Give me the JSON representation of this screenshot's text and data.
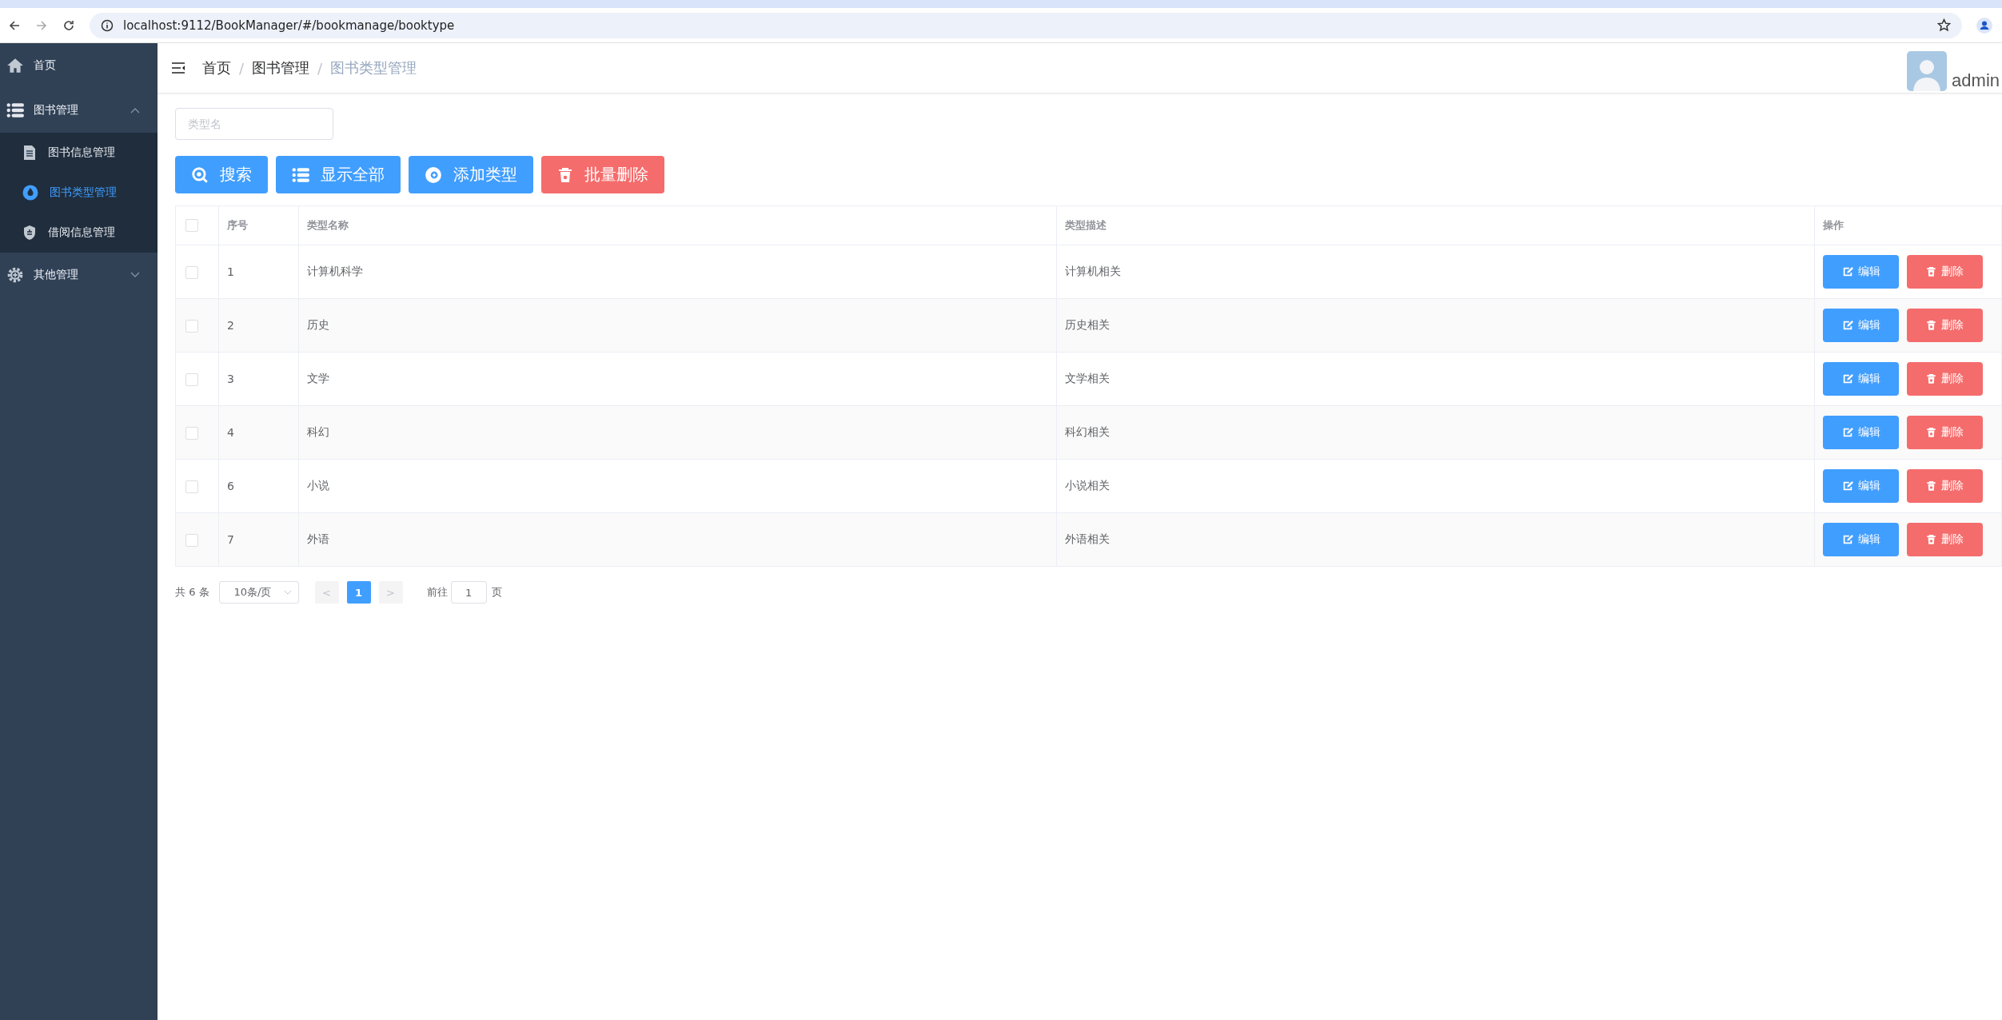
{
  "browser": {
    "url": "localhost:9112/BookManager/#/bookmanage/booktype"
  },
  "sidebar": {
    "items": [
      {
        "label": "首页",
        "selected": false
      },
      {
        "label": "图书管理",
        "selected": false,
        "expanded": true,
        "children": [
          {
            "label": "图书信息管理",
            "selected": false
          },
          {
            "label": "图书类型管理",
            "selected": true
          },
          {
            "label": "借阅信息管理",
            "selected": false
          }
        ]
      },
      {
        "label": "其他管理",
        "selected": false,
        "expanded": false
      }
    ]
  },
  "header": {
    "breadcrumb": [
      "首页",
      "图书管理",
      "图书类型管理"
    ],
    "breadcrumb_separator": "/",
    "user": "admin"
  },
  "filter": {
    "placeholder": "类型名"
  },
  "toolbar": [
    {
      "label": "搜索",
      "kind": "primary"
    },
    {
      "label": "显示全部",
      "kind": "primary"
    },
    {
      "label": "添加类型",
      "kind": "primary"
    },
    {
      "label": "批量删除",
      "kind": "danger"
    }
  ],
  "table": {
    "select_all_checked": false,
    "columns": [
      "序号",
      "类型名称",
      "类型描述",
      "操作"
    ],
    "rows": [
      {
        "checked": false,
        "cells": [
          "1",
          "计算机科学",
          "计算机相关"
        ],
        "actions": [
          "编辑",
          "删除"
        ]
      },
      {
        "checked": false,
        "cells": [
          "2",
          "历史",
          "历史相关"
        ],
        "actions": [
          "编辑",
          "删除"
        ]
      },
      {
        "checked": false,
        "cells": [
          "3",
          "文学",
          "文学相关"
        ],
        "actions": [
          "编辑",
          "删除"
        ]
      },
      {
        "checked": false,
        "cells": [
          "4",
          "科幻",
          "科幻相关"
        ],
        "actions": [
          "编辑",
          "删除"
        ]
      },
      {
        "checked": false,
        "cells": [
          "6",
          "小说",
          "小说相关"
        ],
        "actions": [
          "编辑",
          "删除"
        ]
      },
      {
        "checked": false,
        "cells": [
          "7",
          "外语",
          "外语相关"
        ],
        "actions": [
          "编辑",
          "删除"
        ]
      }
    ]
  },
  "pagination": {
    "total": "共 6 条",
    "page_size": "10条/页",
    "prev": "<",
    "next": ">",
    "pages": [
      {
        "label": "1",
        "selected": true
      }
    ],
    "goto_label": "前往",
    "goto_value": "1",
    "goto_suffix": "页"
  }
}
